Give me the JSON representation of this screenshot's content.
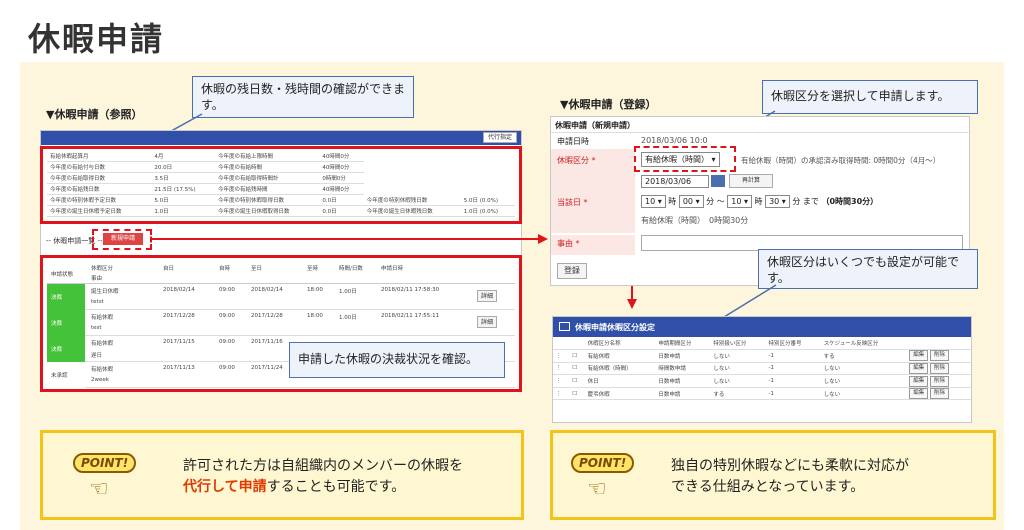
{
  "title": "休暇申請",
  "ref": {
    "section_title": "▼休暇申請（参照）",
    "callout": "休暇の残日数・残時間の確認ができます。",
    "proxy_button": "代行指定",
    "summary_rows": [
      [
        "有給休暇起算月",
        "4月",
        "今年度の有給上限時間",
        "40時間0分"
      ],
      [
        "今年度の有給付与日数",
        "20.0日",
        "今年度の有給時間",
        "40時間0分"
      ],
      [
        "今年度の有給取得日数",
        "3.5日",
        "今年度の有給取得時間計",
        "0時間0分"
      ],
      [
        "今年度の有給残日数",
        "21.5日 (17.5%)",
        "今年度の有給残時間",
        "40時間0分"
      ],
      [
        "今年度の特別休暇予定日数",
        "5.0日",
        "今年度の特別休暇取得日数",
        "0.0日",
        "今年度の特別休暇残日数",
        "5.0日 (0.0%)"
      ],
      [
        "今年度の誕生日休暇予定日数",
        "1.0日",
        "今年度の誕生日休暇取得日数",
        "0.0日",
        "今年度の誕生日休暇残日数",
        "1.0日 (0.0%)"
      ]
    ],
    "list_label": "-- 休暇申請一覧 --",
    "new_button": "新規申請",
    "list_headers": [
      "申請状態",
      "休暇区分",
      "自日",
      "自時",
      "至日",
      "至時",
      "時間/日数",
      "申請日時"
    ],
    "list_sub_header": "事由",
    "rows": [
      {
        "status": "決裁",
        "type": "誕生日休暇",
        "reason": "tetst",
        "from": "2018/02/14",
        "ft": "09:00",
        "to": "2018/02/14",
        "tt": "18:00",
        "days": "1.00日",
        "applied": "2018/02/11 17:58:30",
        "btn": "詳細",
        "color": "#44c23a"
      },
      {
        "status": "決裁",
        "type": "有給休暇",
        "reason": "test",
        "from": "2017/12/28",
        "ft": "09:00",
        "to": "2017/12/28",
        "tt": "18:00",
        "days": "1.00日",
        "applied": "2018/02/11 17:55:11",
        "btn": "詳細",
        "color": "#44c23a"
      },
      {
        "status": "決裁",
        "type": "有給休暇",
        "reason": "遅日",
        "from": "2017/11/15",
        "ft": "09:00",
        "to": "2017/11/16",
        "tt": "",
        "days": "",
        "applied": "",
        "btn": "",
        "color": "#44c23a"
      },
      {
        "status": "未承認",
        "type": "有給休暇",
        "reason": "2week",
        "from": "2017/11/13",
        "ft": "09:00",
        "to": "2017/11/24",
        "tt": "",
        "days": "",
        "applied": "",
        "btn": "",
        "color": "#ffffff"
      }
    ],
    "callout2": "申請した休暇の決裁状況を確認。"
  },
  "reg": {
    "section_title": "▼休暇申請（登録）",
    "callout": "休暇区分を選択して申請します。",
    "form_title": "休暇申請（新規申請）",
    "labels": {
      "datetime": "申請日時",
      "type": "休暇区分 *",
      "day": "当該日 *",
      "reason": "事由 *"
    },
    "datetime": "2018/03/06 10:0",
    "type_select": "有給休暇（時間）",
    "type_note": "有給休暇（時間）の承認済み取得時間: 0時間0分（4月〜）",
    "date": "2018/03/06",
    "recalc": "再計算",
    "time_from_h": "10",
    "time_from_m": "00",
    "time_to_h": "10",
    "time_to_m": "30",
    "unit_h": "時",
    "unit_m": "分",
    "tilde": "〜",
    "until": "分 まで",
    "duration": "（0時間30分）",
    "summary": "有給休暇（時間）　0時間30分",
    "submit": "登録"
  },
  "settings": {
    "callout": "休暇区分はいくつでも設定が可能です。",
    "title": "休暇申請休暇区分設定",
    "headers": [
      "休暇区分名称",
      "申請期間区分",
      "特別扱い区分",
      "特別区分番号",
      "スケジュール反映区分"
    ],
    "rows": [
      [
        "有給休暇",
        "日数申請",
        "しない",
        "-1",
        "する"
      ],
      [
        "有給休暇（時間）",
        "時間数申請",
        "しない",
        "-1",
        "しない"
      ],
      [
        "休日",
        "日数申請",
        "しない",
        "-1",
        "しない"
      ],
      [
        "慶弔休暇",
        "日数申請",
        "する",
        "-1",
        "しない"
      ]
    ],
    "edit": "編集",
    "delete": "削除"
  },
  "point_left": {
    "badge": "POINT!",
    "text1": "許可された方は自組織内のメンバーの休暇を",
    "highlight": "代行して申請",
    "text2": "することも可能です。"
  },
  "point_right": {
    "badge": "POINT!",
    "text1": "独自の特別休暇などにも柔軟に対応が",
    "text2": "できる仕組みとなっています。"
  },
  "colors": {
    "accent_red": "#e0121b",
    "header_blue": "#2f4fa8",
    "approved_green": "#44c23a",
    "highlight_text": "#e03a00"
  }
}
